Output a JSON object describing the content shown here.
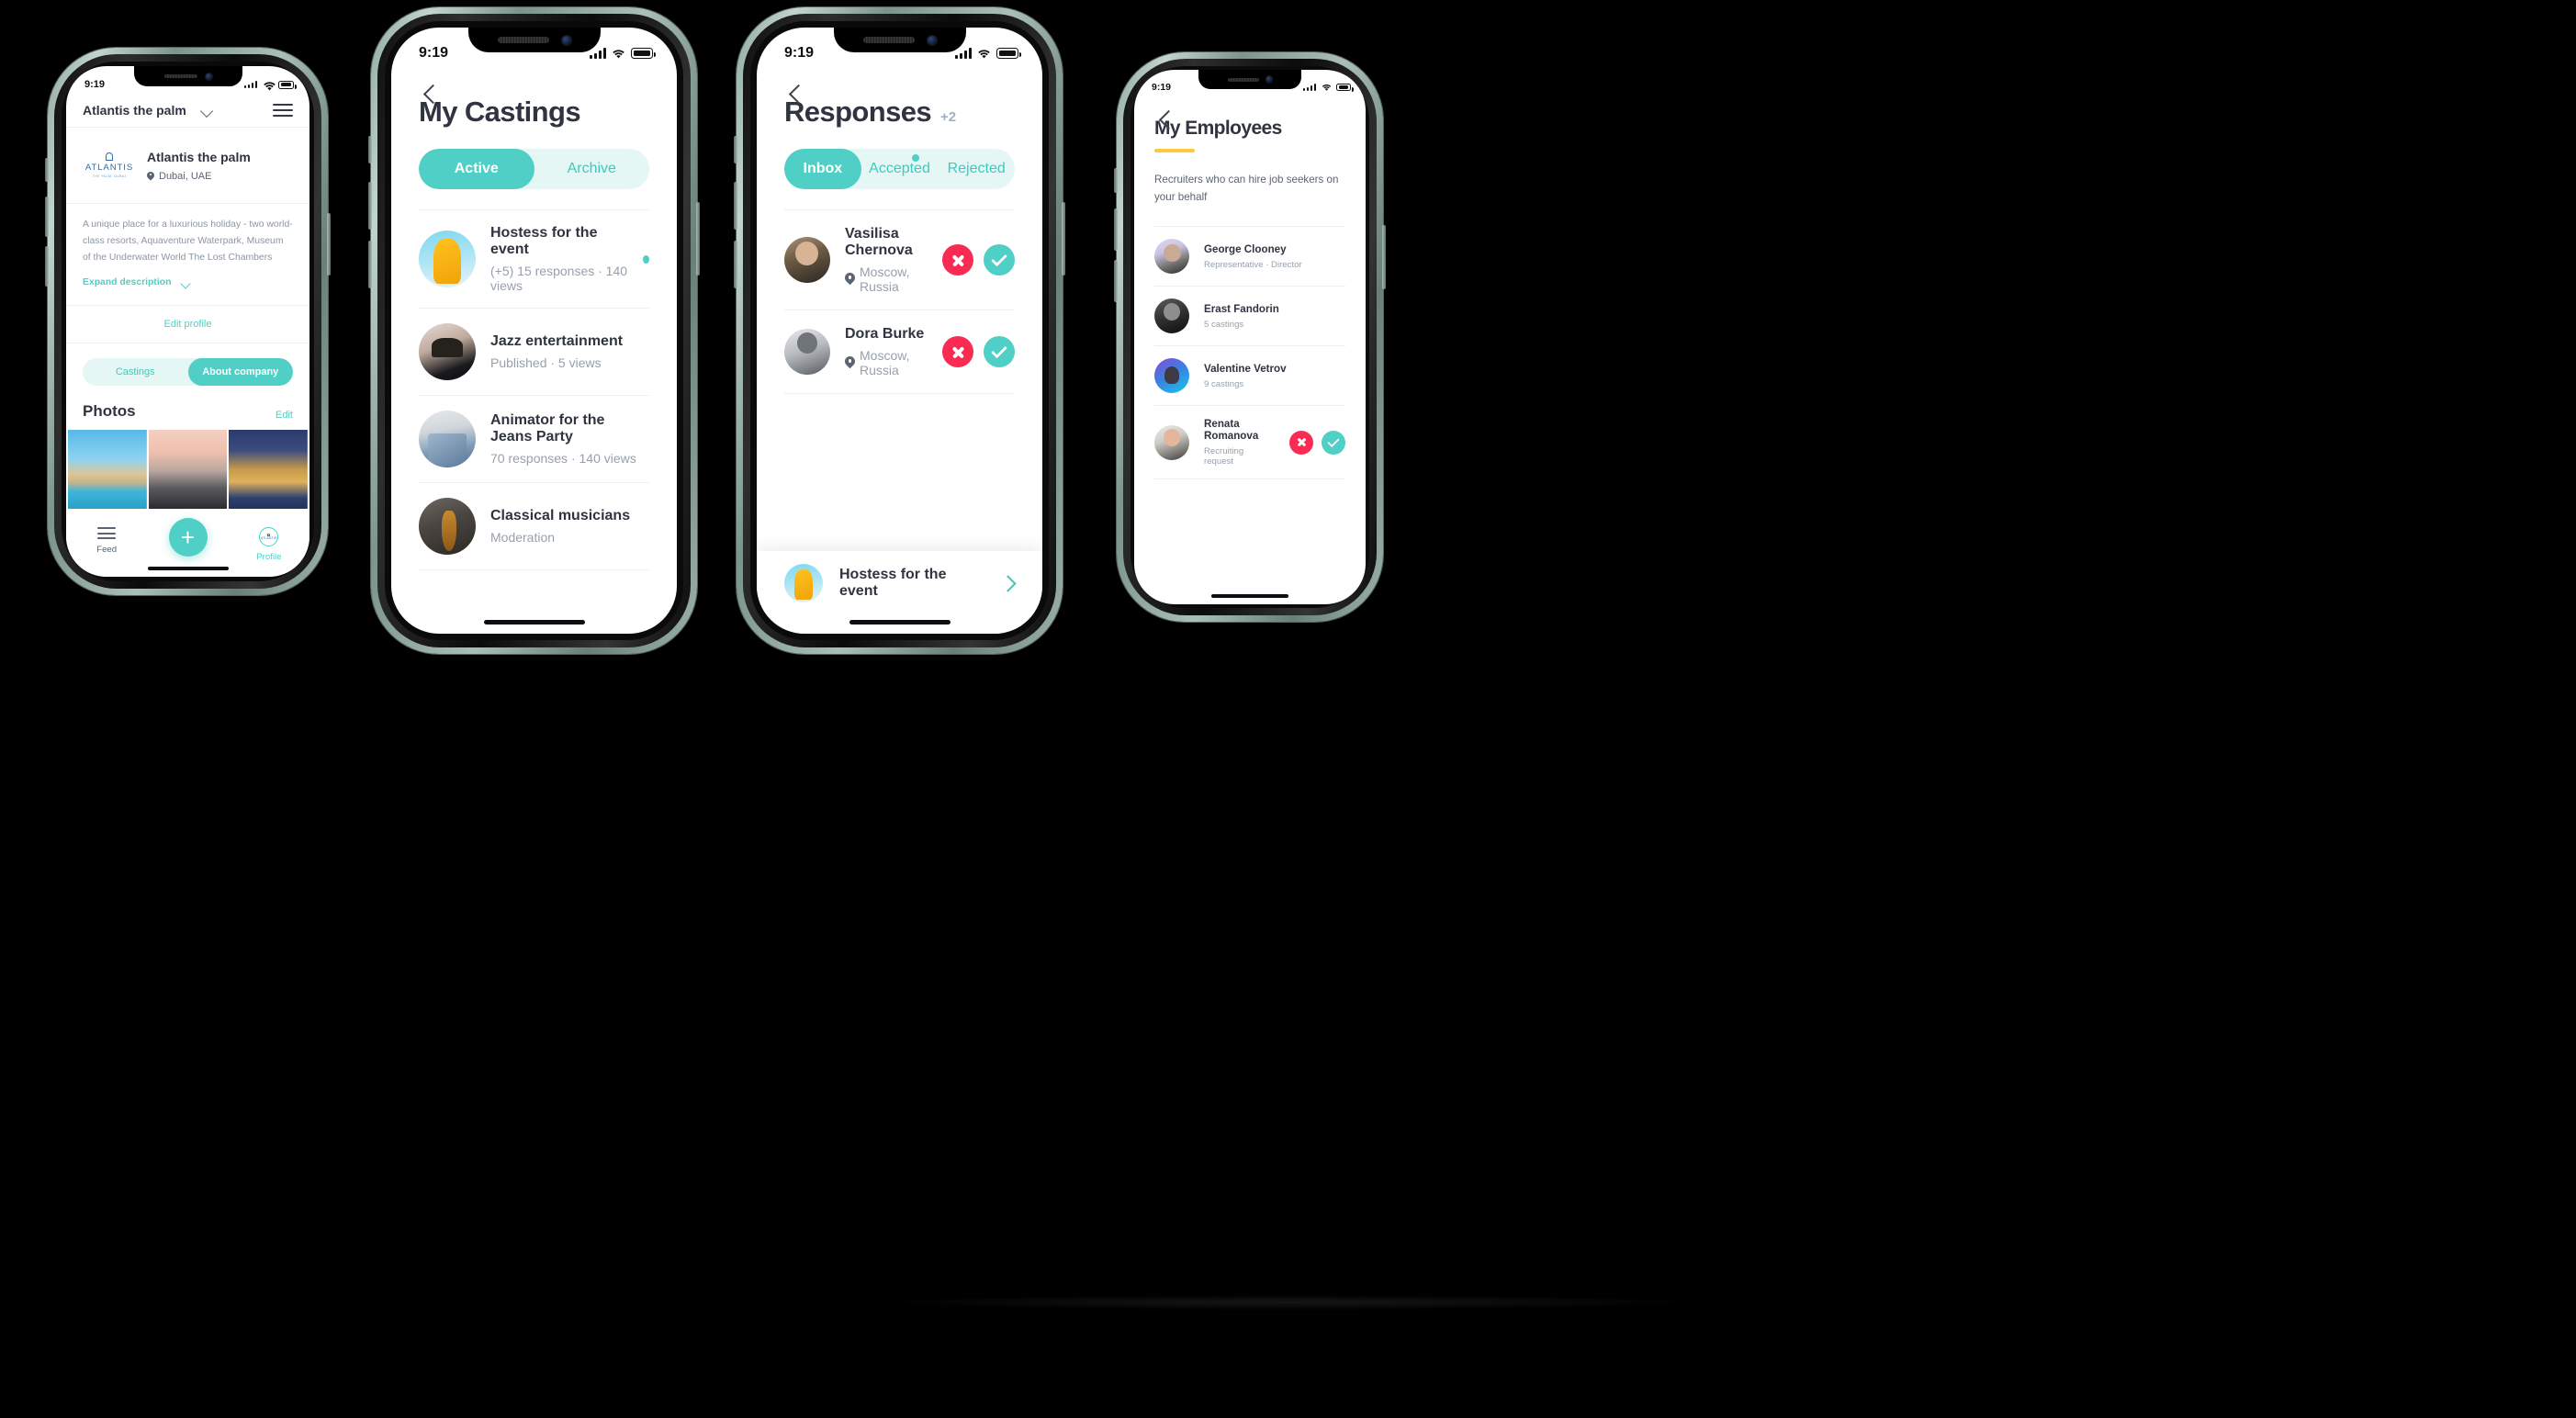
{
  "status_bar": {
    "time": "9:19",
    "signal_icon": "cellular-bars-icon",
    "wifi_icon": "wifi-icon",
    "battery_icon": "battery-full-icon"
  },
  "phone1": {
    "name": "company-profile-screen",
    "header": {
      "title": "Atlantis the palm",
      "chevron_icon": "chevron-down-icon",
      "menu_icon": "hamburger-menu-icon"
    },
    "company": {
      "logo_word": "ATLANTIS",
      "logo_sub": "THE PALM, DUBAI",
      "name": "Atlantis the palm",
      "location": "Dubai, UAE",
      "location_icon": "map-pin-icon"
    },
    "description": "A unique place for a luxurious holiday - two world-class resorts, Aquaventure Waterpark, Museum of the Underwater World The Lost Chambers",
    "expand_label": "Expand description",
    "expand_icon": "chevron-down-icon",
    "edit_profile_label": "Edit profile",
    "segments": [
      {
        "label": "Castings",
        "active": false
      },
      {
        "label": "About company",
        "active": true
      }
    ],
    "photos": {
      "heading": "Photos",
      "edit_label": "Edit",
      "items": [
        "Atlantis The Palm daytime",
        "Dubai skyline",
        "Atlantis The Palm at night"
      ]
    },
    "tabbar": {
      "feed_label": "Feed",
      "feed_icon": "list-lines-icon",
      "add_label": "+",
      "add_icon": "plus-icon",
      "profile_label": "Profile",
      "profile_icon": "company-avatar-icon"
    }
  },
  "phone2": {
    "name": "my-castings-screen",
    "back_icon": "back-chevron-icon",
    "title": "My Castings",
    "tabs": [
      {
        "label": "Active",
        "active": true
      },
      {
        "label": "Archive",
        "active": false
      }
    ],
    "castings": [
      {
        "title": "Hostess for the event",
        "meta": "(+5) 15 responses · 140 views",
        "unread": true,
        "avatar": "hostess-avatar"
      },
      {
        "title": "Jazz entertainment",
        "meta": "Published · 5 views",
        "unread": false,
        "avatar": "jazz-avatar"
      },
      {
        "title": "Animator for the Jeans Party",
        "meta": "70 responses · 140 views",
        "unread": false,
        "avatar": "jeans-avatar"
      },
      {
        "title": "Classical musicians",
        "meta": "Moderation",
        "unread": false,
        "avatar": "cello-avatar"
      }
    ]
  },
  "phone3": {
    "name": "responses-screen",
    "back_icon": "back-chevron-icon",
    "title": "Responses",
    "title_badge": "+2",
    "tabs": [
      {
        "label": "Inbox",
        "active": true,
        "dot": false
      },
      {
        "label": "Accepted",
        "active": false,
        "dot": true
      },
      {
        "label": "Rejected",
        "active": false,
        "dot": false
      }
    ],
    "responses": [
      {
        "name": "Vasilisa Chernova",
        "location": "Moscow, Russia",
        "location_icon": "map-pin-icon",
        "avatar": "vasilisa-avatar"
      },
      {
        "name": "Dora Burke",
        "location": "Moscow, Russia",
        "location_icon": "map-pin-icon",
        "avatar": "dora-avatar"
      }
    ],
    "actions": {
      "reject_icon": "close-x-icon",
      "accept_icon": "check-icon"
    },
    "footer": {
      "title": "Hostess for the event",
      "avatar": "hostess-avatar",
      "chevron_icon": "chevron-right-icon"
    }
  },
  "phone4": {
    "name": "my-employees-screen",
    "back_icon": "back-chevron-icon",
    "title": "My Employees",
    "underline_color": "#ffc93c",
    "intro": "Recruiters who can hire job seekers on your behalf",
    "employees": [
      {
        "name": "George Clooney",
        "meta": "Representative · Director",
        "actions": false,
        "avatar": "george-avatar"
      },
      {
        "name": "Erast Fandorin",
        "meta": "5 castings",
        "actions": false,
        "avatar": "erast-avatar"
      },
      {
        "name": "Valentine Vetrov",
        "meta": "9 castings",
        "actions": false,
        "avatar": "valentine-avatar"
      },
      {
        "name": "Renata Romanova",
        "meta": "Recruiting request",
        "actions": true,
        "avatar": "renata-avatar"
      }
    ],
    "actions": {
      "reject_icon": "close-x-icon",
      "accept_icon": "check-icon"
    }
  },
  "colors": {
    "accent_teal": "#4fcfc6",
    "accent_teal_soft": "#e4f7f5",
    "reject_red": "#fa2b53",
    "text_dark": "#2f3440",
    "text_muted": "#97a0ae",
    "underline_yellow": "#ffc93c",
    "logo_blue": "#2e6da4",
    "background": "#000000"
  }
}
